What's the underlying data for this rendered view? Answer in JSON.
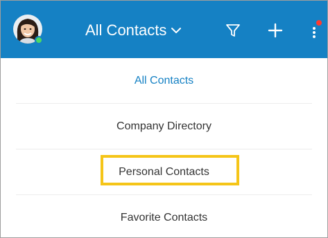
{
  "header": {
    "title": "All Contacts",
    "icons": {
      "avatar": "user-avatar",
      "presence": "online-status-dot",
      "dropdown": "chevron-down-icon",
      "filter": "filter-icon",
      "add": "plus-icon",
      "more": "more-vertical-icon",
      "notification": "notification-dot"
    }
  },
  "menu": {
    "items": [
      {
        "label": "All Contacts",
        "selected": true
      },
      {
        "label": "Company Directory",
        "selected": false
      },
      {
        "label": "Personal Contacts",
        "selected": false,
        "highlighted": true
      },
      {
        "label": "Favorite Contacts",
        "selected": false
      }
    ]
  },
  "colors": {
    "appbar": "#1581c4",
    "selected_text": "#1581c4",
    "text": "#333333",
    "highlight_box": "#f5c518",
    "presence": "#4cd964",
    "notification": "#ff3b30"
  }
}
